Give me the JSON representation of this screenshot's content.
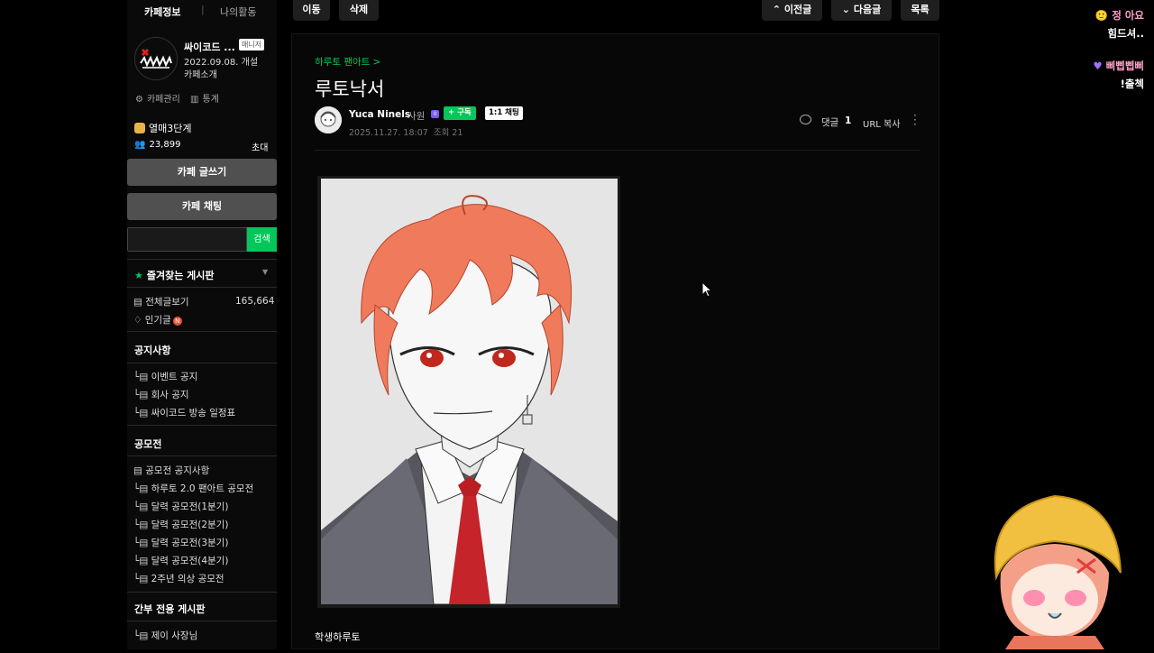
{
  "sidebar": {
    "tabs": [
      "카페정보",
      "나의활동"
    ],
    "tab_separator": "|",
    "cafe": {
      "name": "싸이코드 ...",
      "manager_badge": "매니저",
      "founded": "2022.09.08. 개설",
      "intro_link": "카페소개",
      "admin_link": "카페관리",
      "stats_link": "통계",
      "level": "열매3단계",
      "members": "23,899",
      "invite": "초대"
    },
    "write_button": "카페 글쓰기",
    "chat_button": "카페 채팅",
    "search": {
      "value": "",
      "button": "검색"
    },
    "favorites_title": "즐겨찾는 게시판",
    "all_posts": "전체글보기",
    "all_posts_count": "165,664",
    "popular": "인기글",
    "popular_badge": "N",
    "sections": [
      {
        "title": "공지사항",
        "items": [
          "이벤트 공지",
          "회사 공지",
          "싸이코드 방송 일정표"
        ]
      },
      {
        "title": "공모전",
        "items": [
          "공모전 공지사항",
          "하루토 2.0 팬아트 공모전",
          "달력 공모전(1분기)",
          "달력 공모전(2분기)",
          "달력 공모전(3분기)",
          "달력 공모전(4분기)",
          "2주년 의상 공모전"
        ]
      },
      {
        "title": "간부 전용 게시판",
        "items": [
          "제이 사장님"
        ]
      }
    ]
  },
  "toolbar": {
    "move": "이동",
    "delete": "삭제",
    "prev": "이전글",
    "next": "다음글",
    "list": "목록"
  },
  "article": {
    "board": "하루토 팬아트 >",
    "title": "루토낙서",
    "author": "Yuca Ninels",
    "rank": "사원",
    "rank_icon": "II",
    "subscribe": "+ 구독",
    "chat": "1:1 채팅",
    "date": "2025.11.27. 18:07",
    "views": "조회 21",
    "comments_label": "댓글",
    "comments_count": "1",
    "url_copy": "URL 복사",
    "caption": "학생하루토"
  },
  "overlay": {
    "chat": [
      {
        "nick": "정 아요",
        "message": "힘드셔.."
      },
      {
        "nick": "삐삡삡삐",
        "message": "!출첵"
      }
    ]
  },
  "colors": {
    "accent_green": "#03c75a",
    "background": "#000000",
    "sidebar_bg": "#0a0a0a",
    "button_gray": "#505050",
    "hair": "#ef7b5c"
  }
}
